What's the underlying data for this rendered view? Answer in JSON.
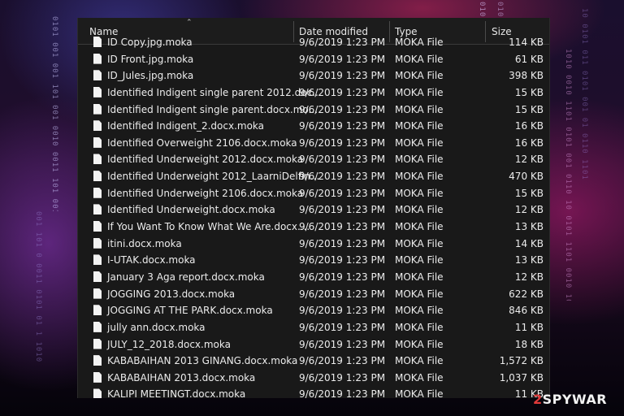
{
  "columns": {
    "name": "Name",
    "date": "Date modified",
    "type": "Type",
    "size": "Size"
  },
  "files": [
    {
      "name": "ID Copy.jpg.moka",
      "date": "9/6/2019 1:23 PM",
      "type": "MOKA File",
      "size": "114 KB"
    },
    {
      "name": "ID Front.jpg.moka",
      "date": "9/6/2019 1:23 PM",
      "type": "MOKA File",
      "size": "61 KB"
    },
    {
      "name": "ID_Jules.jpg.moka",
      "date": "9/6/2019 1:23 PM",
      "type": "MOKA File",
      "size": "398 KB"
    },
    {
      "name": "Identified Indigent single parent 2012.doc...",
      "date": "9/6/2019 1:23 PM",
      "type": "MOKA File",
      "size": "15 KB"
    },
    {
      "name": "Identified Indigent single parent.docx.mo...",
      "date": "9/6/2019 1:23 PM",
      "type": "MOKA File",
      "size": "15 KB"
    },
    {
      "name": "Identified Indigent_2.docx.moka",
      "date": "9/6/2019 1:23 PM",
      "type": "MOKA File",
      "size": "16 KB"
    },
    {
      "name": "Identified Overweight 2106.docx.moka",
      "date": "9/6/2019 1:23 PM",
      "type": "MOKA File",
      "size": "16 KB"
    },
    {
      "name": "Identified Underweight 2012.docx.moka",
      "date": "9/6/2019 1:23 PM",
      "type": "MOKA File",
      "size": "12 KB"
    },
    {
      "name": "Identified Underweight 2012_LaarniDelfin...",
      "date": "9/6/2019 1:23 PM",
      "type": "MOKA File",
      "size": "470 KB"
    },
    {
      "name": "Identified Underweight 2106.docx.moka",
      "date": "9/6/2019 1:23 PM",
      "type": "MOKA File",
      "size": "15 KB"
    },
    {
      "name": "Identified Underweight.docx.moka",
      "date": "9/6/2019 1:23 PM",
      "type": "MOKA File",
      "size": "12 KB"
    },
    {
      "name": "If You Want To Know What We Are.docx....",
      "date": "9/6/2019 1:23 PM",
      "type": "MOKA File",
      "size": "13 KB"
    },
    {
      "name": "itini.docx.moka",
      "date": "9/6/2019 1:23 PM",
      "type": "MOKA File",
      "size": "14 KB"
    },
    {
      "name": "I-UTAK.docx.moka",
      "date": "9/6/2019 1:23 PM",
      "type": "MOKA File",
      "size": "13 KB"
    },
    {
      "name": "January 3 Aga report.docx.moka",
      "date": "9/6/2019 1:23 PM",
      "type": "MOKA File",
      "size": "12 KB"
    },
    {
      "name": "JOGGING 2013.docx.moka",
      "date": "9/6/2019 1:23 PM",
      "type": "MOKA File",
      "size": "622 KB"
    },
    {
      "name": "JOGGING AT THE PARK.docx.moka",
      "date": "9/6/2019 1:23 PM",
      "type": "MOKA File",
      "size": "846 KB"
    },
    {
      "name": "jully ann.docx.moka",
      "date": "9/6/2019 1:23 PM",
      "type": "MOKA File",
      "size": "11 KB"
    },
    {
      "name": "JULY_12_2018.docx.moka",
      "date": "9/6/2019 1:23 PM",
      "type": "MOKA File",
      "size": "18 KB"
    },
    {
      "name": "KABABAIHAN 2013 GINANG.docx.moka",
      "date": "9/6/2019 1:23 PM",
      "type": "MOKA File",
      "size": "1,572 KB"
    },
    {
      "name": "KABABAIHAN 2013.docx.moka",
      "date": "9/6/2019 1:23 PM",
      "type": "MOKA File",
      "size": "1,037 KB"
    },
    {
      "name": "KALIPI MEETINGT.docx.moka",
      "date": "9/6/2019 1:23 PM",
      "type": "MOKA File",
      "size": "11 KB"
    }
  ],
  "icon": "file-icon",
  "watermark": {
    "two": "2",
    "text": "SPYWAR"
  },
  "colors": {
    "window_bg": "#191919",
    "text": "#ececec",
    "watermark_accent": "#e03a3a"
  }
}
